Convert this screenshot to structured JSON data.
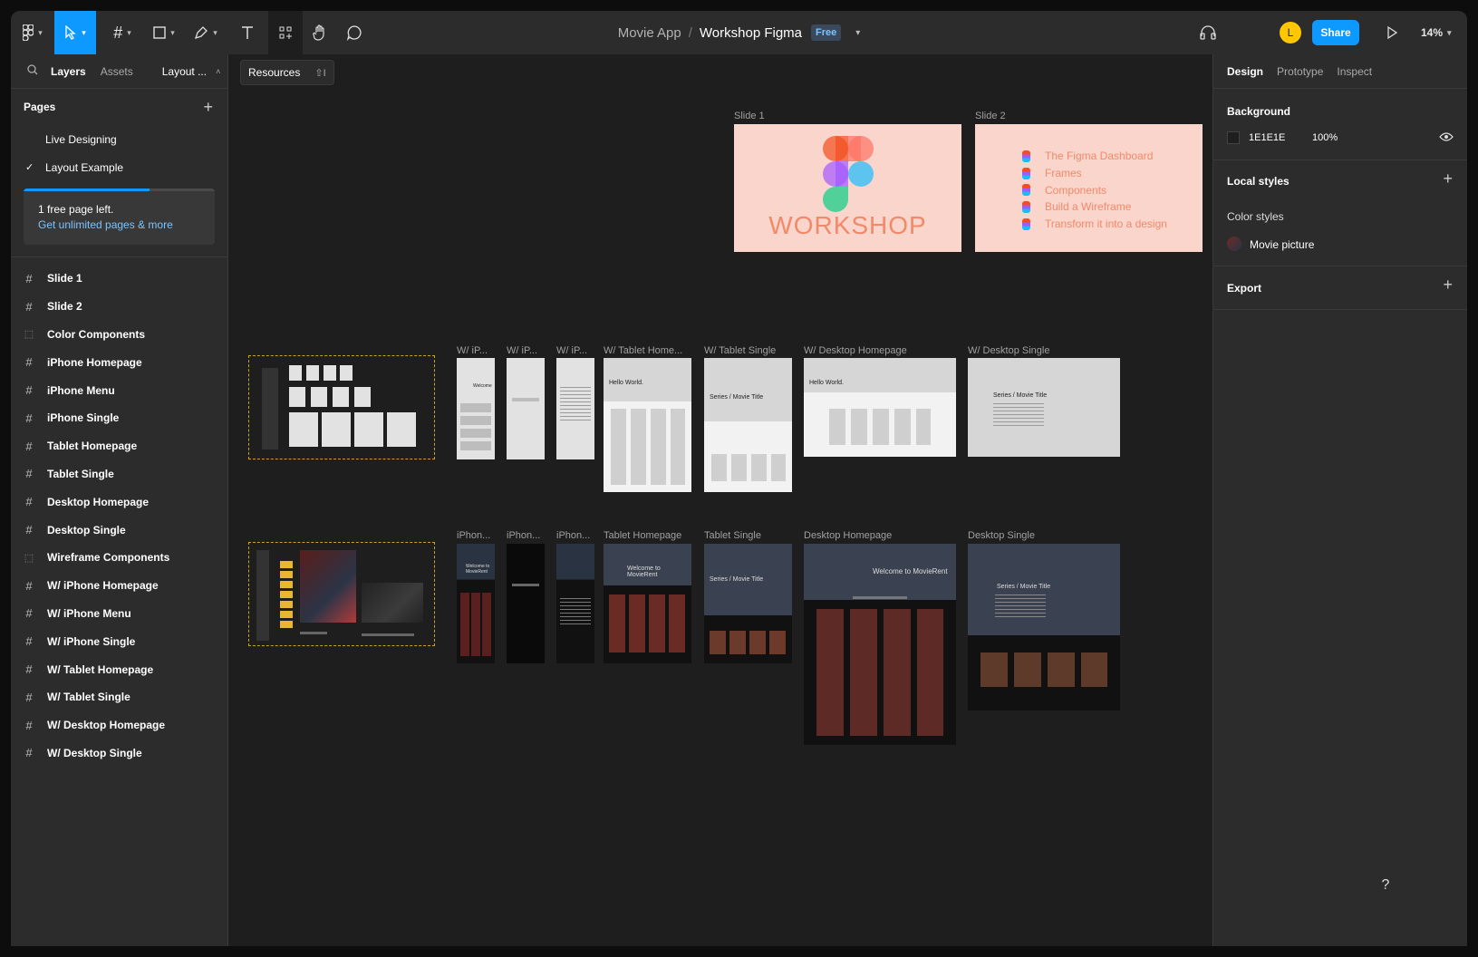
{
  "toolbar": {
    "zoom": "14%",
    "avatar_initial": "L",
    "share_label": "Share",
    "project": "Movie App",
    "separator": "/",
    "file": "Workshop Figma",
    "plan_badge": "Free"
  },
  "left_panel": {
    "tabs": [
      "Layers",
      "Assets",
      "Layout ..."
    ],
    "pages_label": "Pages",
    "pages": [
      {
        "label": "Live Designing",
        "active": false
      },
      {
        "label": "Layout Example",
        "active": true
      }
    ],
    "upgrade": {
      "text": "1 free page left.",
      "link": "Get unlimited pages & more",
      "progress": 0.66
    },
    "layers": [
      {
        "label": "Slide 1",
        "icon": "frame-icon"
      },
      {
        "label": "Slide 2",
        "icon": "frame-icon"
      },
      {
        "label": "Color Components",
        "icon": "section-icon"
      },
      {
        "label": "iPhone Homepage",
        "icon": "frame-icon"
      },
      {
        "label": "iPhone Menu",
        "icon": "frame-icon"
      },
      {
        "label": "iPhone Single",
        "icon": "frame-icon"
      },
      {
        "label": "Tablet Homepage",
        "icon": "frame-icon"
      },
      {
        "label": "Tablet Single",
        "icon": "frame-icon"
      },
      {
        "label": "Desktop Homepage",
        "icon": "frame-icon"
      },
      {
        "label": "Desktop Single",
        "icon": "frame-icon"
      },
      {
        "label": "Wireframe Components",
        "icon": "section-icon"
      },
      {
        "label": "W/ iPhone Homepage",
        "icon": "frame-icon"
      },
      {
        "label": "W/ iPhone Menu",
        "icon": "frame-icon"
      },
      {
        "label": "W/ iPhone Single",
        "icon": "frame-icon"
      },
      {
        "label": "W/ Tablet Homepage",
        "icon": "frame-icon"
      },
      {
        "label": "W/ Tablet Single",
        "icon": "frame-icon"
      },
      {
        "label": "W/ Desktop Homepage",
        "icon": "frame-icon"
      },
      {
        "label": "W/ Desktop Single",
        "icon": "frame-icon"
      }
    ]
  },
  "canvas": {
    "resources_tooltip": "Resources",
    "resources_shortcut": "⇧I",
    "slide1": {
      "label": "Slide 1",
      "text": "WORKSHOP"
    },
    "slide2": {
      "label": "Slide 2",
      "items": [
        "The Figma Dashboard",
        "Frames",
        "Components",
        "Build a Wireframe",
        "Transform it into a design"
      ]
    },
    "wireframe_labels": [
      "W/ iP...",
      "W/ iP...",
      "W/ iP...",
      "W/ Tablet Home...",
      "W/ Tablet Single",
      "W/ Desktop Homepage",
      "W/ Desktop Single"
    ],
    "design_labels": [
      "iPhon...",
      "iPhon...",
      "iPhon...",
      "Tablet Homepage",
      "Tablet Single",
      "Desktop Homepage",
      "Desktop Single"
    ],
    "wf_texts": {
      "hello": "Hello World.",
      "welcome": "Welcome",
      "series": "Series / Movie Title"
    },
    "dk_texts": {
      "welcome": "Welcome to MovieRent",
      "series": "Series / Movie Title"
    }
  },
  "right_panel": {
    "tabs": [
      "Design",
      "Prototype",
      "Inspect"
    ],
    "background_label": "Background",
    "background_hex": "1E1E1E",
    "background_opacity": "100%",
    "local_styles_label": "Local styles",
    "color_styles_label": "Color styles",
    "style_name": "Movie picture",
    "export_label": "Export"
  },
  "help_label": "?",
  "colors": {
    "accent": "#0d99ff",
    "canvas": "#1E1E1E",
    "selection": "#c9a227",
    "slide_bg": "#f9d5cc",
    "slide_text": "#f08a6a"
  }
}
